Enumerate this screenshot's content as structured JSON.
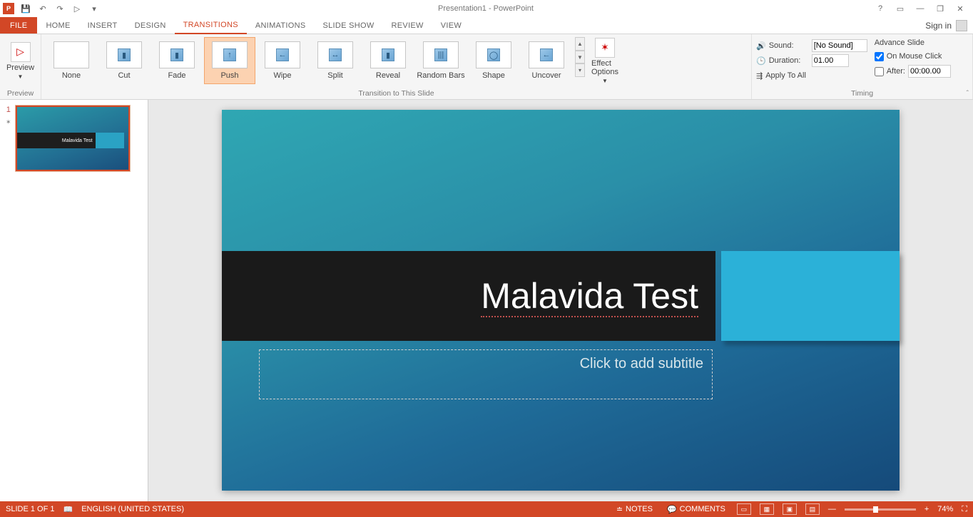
{
  "app": {
    "title": "Presentation1 - PowerPoint",
    "logo": "P"
  },
  "qat": {
    "save": "💾",
    "undo": "↶",
    "redo": "↷",
    "start": "▷"
  },
  "window": {
    "help": "?",
    "ribbonOpt": "▭",
    "min": "—",
    "max": "❐",
    "close": "✕"
  },
  "tabs": {
    "file": "FILE",
    "home": "HOME",
    "insert": "INSERT",
    "design": "DESIGN",
    "transitions": "TRANSITIONS",
    "animations": "ANIMATIONS",
    "slideshow": "SLIDE SHOW",
    "review": "REVIEW",
    "view": "VIEW",
    "signin": "Sign in"
  },
  "ribbon": {
    "preview": {
      "btn": "Preview",
      "group": "Preview"
    },
    "gallery": {
      "group": "Transition to This Slide",
      "items": [
        "None",
        "Cut",
        "Fade",
        "Push",
        "Wipe",
        "Split",
        "Reveal",
        "Random Bars",
        "Shape",
        "Uncover"
      ],
      "selected": 3,
      "glyphs": [
        "",
        "▮",
        "▮",
        "↑",
        "←",
        "↔",
        "▮",
        "|||",
        "◯",
        "←"
      ],
      "effect": "Effect Options"
    },
    "timing": {
      "group": "Timing",
      "soundLabel": "Sound:",
      "soundValue": "[No Sound]",
      "durationLabel": "Duration:",
      "durationValue": "01.00",
      "applyAll": "Apply To All",
      "advHead": "Advance Slide",
      "onClick": "On Mouse Click",
      "afterLabel": "After:",
      "afterValue": "00:00.00"
    }
  },
  "slidepanel": {
    "num": "1",
    "star": "✶",
    "thumbTitle": "Malavida Test"
  },
  "slide": {
    "title": "Malavida Test",
    "subtitle": "Click to add subtitle"
  },
  "status": {
    "pos": "SLIDE 1 OF 1",
    "lang": "ENGLISH (UNITED STATES)",
    "notes": "NOTES",
    "comments": "COMMENTS",
    "zoom": "74%"
  }
}
